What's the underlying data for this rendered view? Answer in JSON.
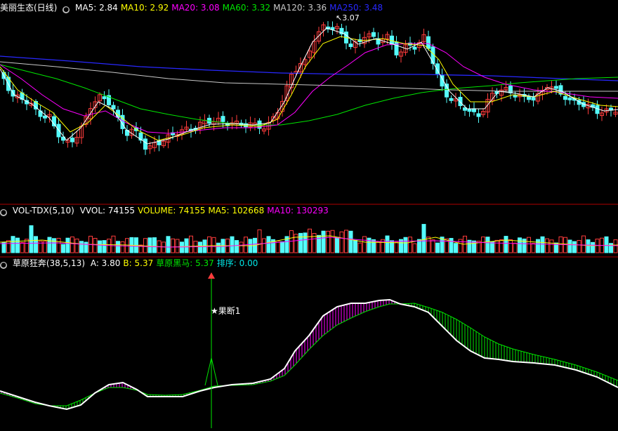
{
  "price_panel": {
    "title": "美丽生态(日线)",
    "indicators": [
      {
        "label": "MA5: 2.84",
        "color": "#ffffff"
      },
      {
        "label": "MA10: 2.92",
        "color": "#ffff00"
      },
      {
        "label": "MA20: 3.08",
        "color": "#ff00ff"
      },
      {
        "label": "MA60: 3.32",
        "color": "#00e600"
      },
      {
        "label": "MA120: 3.36",
        "color": "#c8c8c8"
      },
      {
        "label": "MA250: 3.48",
        "color": "#2828ff"
      }
    ],
    "high_label": "3.07"
  },
  "volume_panel": {
    "title": "VOL-TDX(5,10)",
    "indicators": [
      {
        "label": "VVOL: 74155",
        "color": "#ffffff"
      },
      {
        "label": "VOLUME: 74155",
        "color": "#ffff00"
      },
      {
        "label": "MA5: 102668",
        "color": "#ffff00"
      },
      {
        "label": "MA10: 130293",
        "color": "#ff00ff"
      }
    ]
  },
  "indicator_panel": {
    "title": "草原狂奔(38,5,13)",
    "indicators": [
      {
        "label": "A: 3.80",
        "color": "#ffffff"
      },
      {
        "label": "B: 5.37",
        "color": "#ffff00"
      },
      {
        "label": "草原黑马: 5.37",
        "color": "#00e600"
      },
      {
        "label": "排序: 0.00",
        "color": "#00e6e6"
      }
    ],
    "signal_label": "★果断1"
  },
  "colors": {
    "up": "#ff3c3c",
    "down": "#54fcfc",
    "ma5": "#ffffff",
    "ma10": "#ffff00",
    "ma20": "#ff00ff",
    "ma60": "#00e600",
    "ma120": "#c8c8c8",
    "ma250": "#2828ff",
    "divider": "#b00000"
  },
  "icons": {
    "panel_menu": "circle-menu-icon"
  }
}
